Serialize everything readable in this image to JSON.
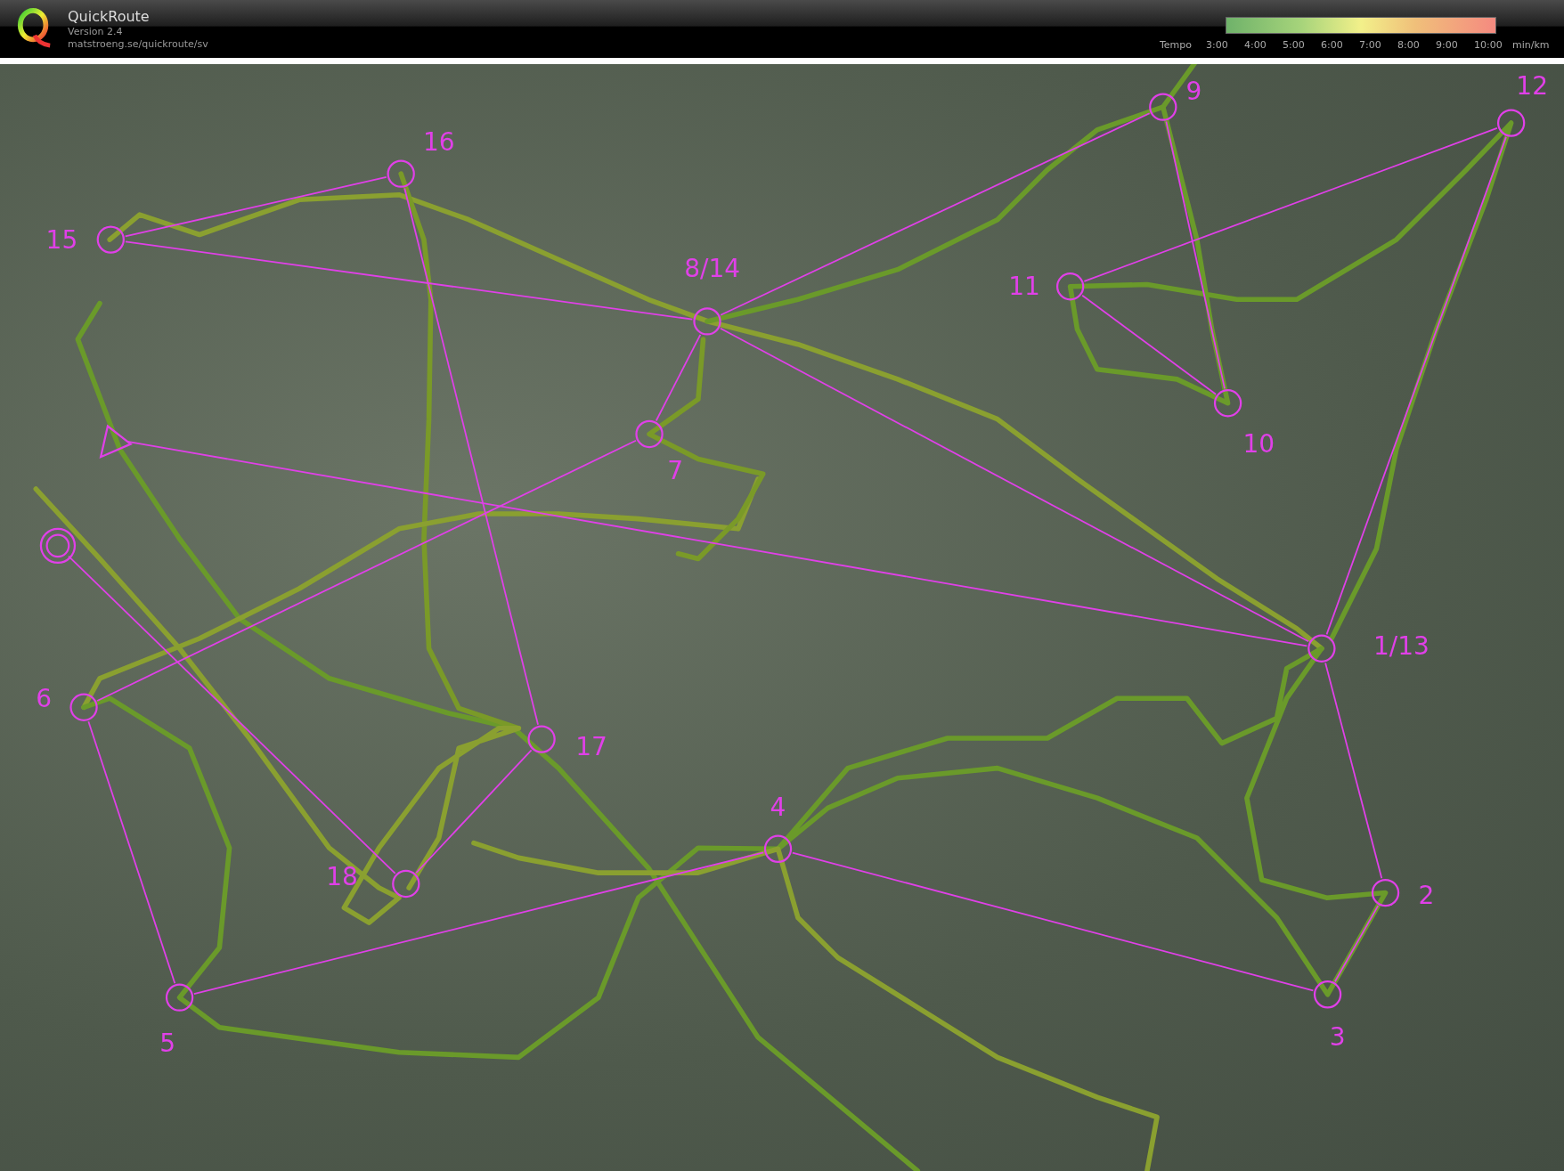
{
  "app": {
    "title": "QuickRoute",
    "version": "Version 2.4",
    "url": "matstroeng.se/quickroute/sv"
  },
  "legend": {
    "label": "Tempo",
    "ticks": [
      "3:00",
      "4:00",
      "5:00",
      "6:00",
      "7:00",
      "8:00",
      "9:00",
      "10:00"
    ],
    "unit": "min/km"
  },
  "course": {
    "start": {
      "kind": "start"
    },
    "finish": {
      "kind": "finish"
    },
    "controls": [
      {
        "label": "1/13"
      },
      {
        "label": "2"
      },
      {
        "label": "3"
      },
      {
        "label": "4"
      },
      {
        "label": "5"
      },
      {
        "label": "6"
      },
      {
        "label": "7"
      },
      {
        "label": "8/14"
      },
      {
        "label": "9"
      },
      {
        "label": "10"
      },
      {
        "label": "11"
      },
      {
        "label": "12"
      },
      {
        "label": "15"
      },
      {
        "label": "16"
      },
      {
        "label": "17"
      },
      {
        "label": "18"
      }
    ]
  }
}
